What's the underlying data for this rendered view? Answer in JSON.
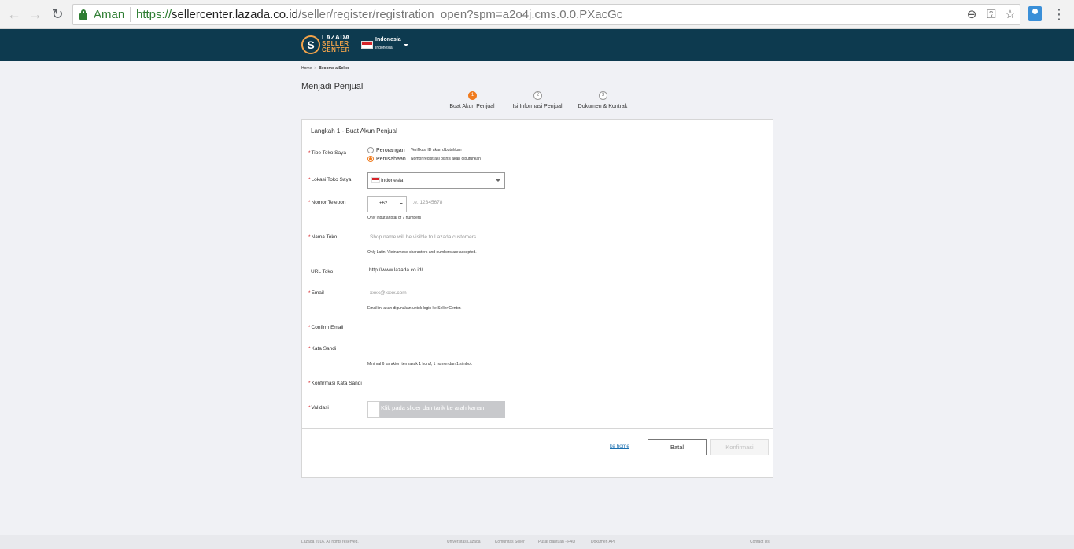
{
  "browser": {
    "back_icon": "←",
    "forward_icon": "→",
    "reload_icon": "↻",
    "secure_label": "Aman",
    "url_proto": "https://",
    "url_host": "sellercenter.lazada.co.id",
    "url_path": "/seller/register/registration_open?spm=a2o4j.cms.0.0.PXacGc",
    "zoom_icon": "⊖",
    "key_icon": "⚿",
    "star_icon": "☆",
    "menu_icon": "⋮"
  },
  "header": {
    "logo_line1": "LAZADA",
    "logo_line2": "SELLER",
    "logo_line3": "CENTER",
    "logo_letter": "S",
    "country_name": "Indonesia",
    "country_sub": "Indonesia"
  },
  "breadcrumb": {
    "home": "Home",
    "separator": ">",
    "current": "Become a Seller"
  },
  "page_title": "Menjadi Penjual",
  "steps": [
    {
      "number": "1",
      "label": "Buat Akun Penjual",
      "active": true
    },
    {
      "number": "2",
      "label": "Isi Informasi Penjual",
      "active": false
    },
    {
      "number": "3",
      "label": "Dokumen & Kontrak",
      "active": false
    }
  ],
  "form": {
    "heading": "Langkah 1 - Buat Akun Penjual",
    "required_mark": "*",
    "shop_type": {
      "label": "Tipe Toko Saya",
      "options": [
        {
          "label": "Perorangan",
          "hint": "Verifikasi ID akan dibutuhkan",
          "checked": false
        },
        {
          "label": "Perusahaan",
          "hint": "Nomor registrasi bisnis akan dibutuhkan",
          "checked": true
        }
      ]
    },
    "location": {
      "label": "Lokasi Toko Saya",
      "value": "Indonesia"
    },
    "phone": {
      "label": "Nomor Telepon",
      "code": "+62",
      "placeholder": "i.e. 12345678",
      "hint": "Only input a total of 7 numbers"
    },
    "shop_name": {
      "label": "Nama Toko",
      "placeholder": "Shop name will be visible to Lazada customers.",
      "hint": "Only Latin, Vietnamese characters and numbers are accepted."
    },
    "shop_url": {
      "label": "URL Toko",
      "value": "http://www.lazada.co.id/"
    },
    "email": {
      "label": "Email",
      "placeholder": "xxxx@xxxx.com",
      "hint": "Email ini akan digunakan untuk login ke Seller Center."
    },
    "confirm_email": {
      "label": "Confirm Email"
    },
    "password": {
      "label": "Kata Sandi",
      "hint": "Minimal 6 karakter, termasuk 1 huruf, 1 nomor dan 1 simbol."
    },
    "confirm_password": {
      "label": "Konfirmasi Kata Sandi"
    },
    "validation": {
      "label": "Validasi",
      "slider_text": "Klik pada slider dan tarik ke arah kanan"
    },
    "actions": {
      "home_link": "ke home",
      "cancel": "Batal",
      "confirm": "Konfirmasi"
    }
  },
  "footer": {
    "copyright": "Lazada 2016. All rights reserved.",
    "links": [
      "Universitas Lazada",
      "Komunitas Seller",
      "Pusat Bantuan - FAQ",
      "Dokumen API"
    ],
    "contact": "Contact Us"
  },
  "colors": {
    "header_bg": "#0d3a4f",
    "accent_orange": "#f07b1e",
    "secure_green": "#2e7d32",
    "link_blue": "#1a6fb0"
  }
}
